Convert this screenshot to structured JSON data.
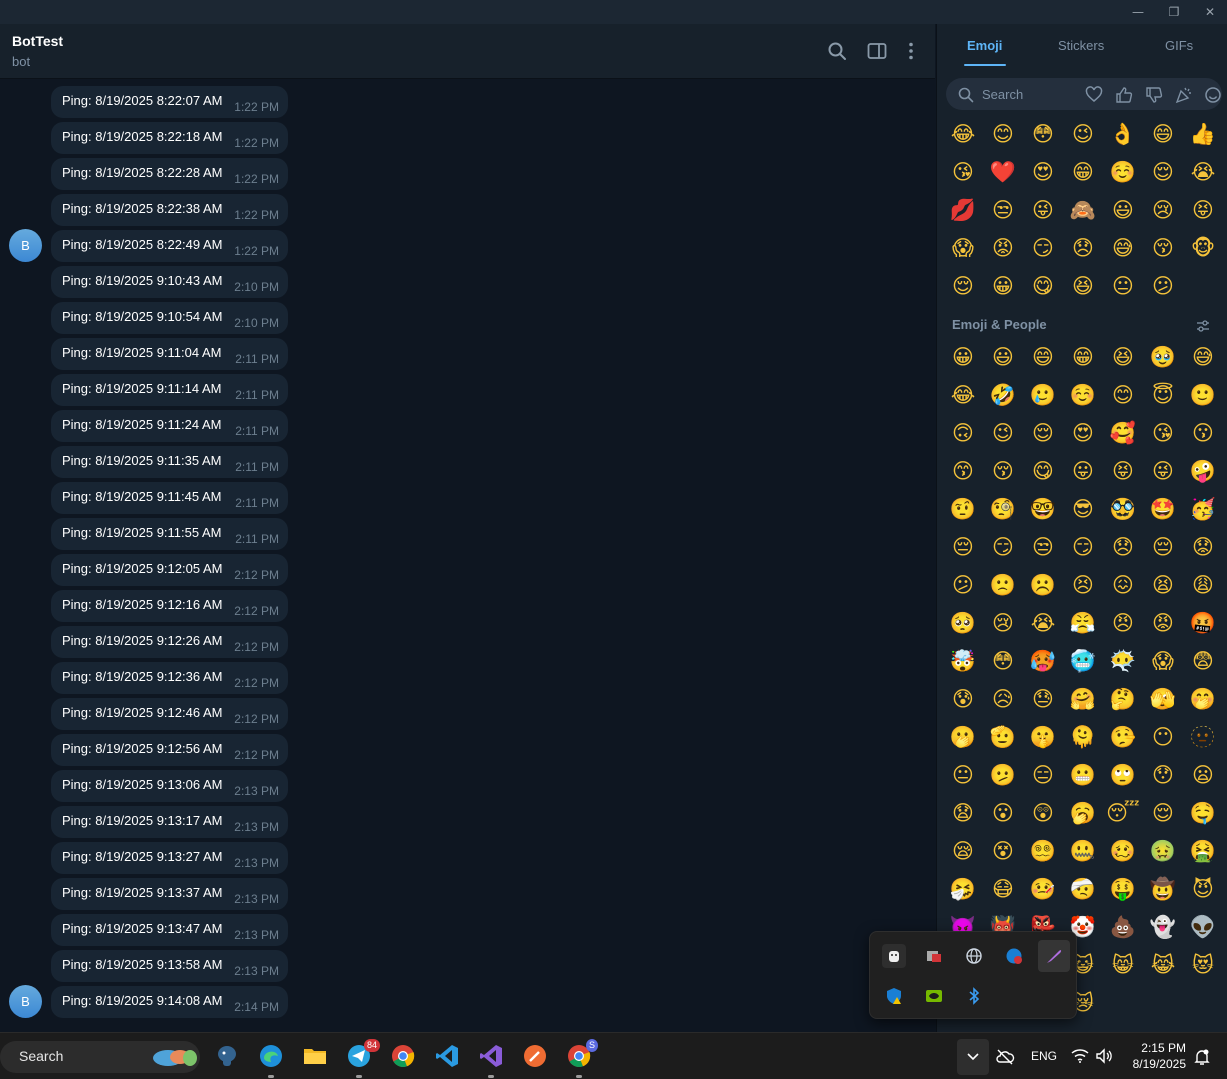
{
  "window": {
    "minimize_glyph": "—",
    "restore_glyph": "❐",
    "close_glyph": "✕"
  },
  "chat": {
    "title": "BotTest",
    "subtitle": "bot"
  },
  "messages": [
    {
      "text": "Ping: 8/19/2025 8:22:07 AM",
      "time": "1:22 PM",
      "avatar": ""
    },
    {
      "text": "Ping: 8/19/2025 8:22:18 AM",
      "time": "1:22 PM",
      "avatar": ""
    },
    {
      "text": "Ping: 8/19/2025 8:22:28 AM",
      "time": "1:22 PM",
      "avatar": ""
    },
    {
      "text": "Ping: 8/19/2025 8:22:38 AM",
      "time": "1:22 PM",
      "avatar": ""
    },
    {
      "text": "Ping: 8/19/2025 8:22:49 AM",
      "time": "1:22 PM",
      "avatar": "B"
    },
    {
      "text": "Ping: 8/19/2025 9:10:43 AM",
      "time": "2:10 PM",
      "avatar": ""
    },
    {
      "text": "Ping: 8/19/2025 9:10:54 AM",
      "time": "2:10 PM",
      "avatar": ""
    },
    {
      "text": "Ping: 8/19/2025 9:11:04 AM",
      "time": "2:11 PM",
      "avatar": ""
    },
    {
      "text": "Ping: 8/19/2025 9:11:14 AM",
      "time": "2:11 PM",
      "avatar": ""
    },
    {
      "text": "Ping: 8/19/2025 9:11:24 AM",
      "time": "2:11 PM",
      "avatar": ""
    },
    {
      "text": "Ping: 8/19/2025 9:11:35 AM",
      "time": "2:11 PM",
      "avatar": ""
    },
    {
      "text": "Ping: 8/19/2025 9:11:45 AM",
      "time": "2:11 PM",
      "avatar": ""
    },
    {
      "text": "Ping: 8/19/2025 9:11:55 AM",
      "time": "2:11 PM",
      "avatar": ""
    },
    {
      "text": "Ping: 8/19/2025 9:12:05 AM",
      "time": "2:12 PM",
      "avatar": ""
    },
    {
      "text": "Ping: 8/19/2025 9:12:16 AM",
      "time": "2:12 PM",
      "avatar": ""
    },
    {
      "text": "Ping: 8/19/2025 9:12:26 AM",
      "time": "2:12 PM",
      "avatar": ""
    },
    {
      "text": "Ping: 8/19/2025 9:12:36 AM",
      "time": "2:12 PM",
      "avatar": ""
    },
    {
      "text": "Ping: 8/19/2025 9:12:46 AM",
      "time": "2:12 PM",
      "avatar": ""
    },
    {
      "text": "Ping: 8/19/2025 9:12:56 AM",
      "time": "2:12 PM",
      "avatar": ""
    },
    {
      "text": "Ping: 8/19/2025 9:13:06 AM",
      "time": "2:13 PM",
      "avatar": ""
    },
    {
      "text": "Ping: 8/19/2025 9:13:17 AM",
      "time": "2:13 PM",
      "avatar": ""
    },
    {
      "text": "Ping: 8/19/2025 9:13:27 AM",
      "time": "2:13 PM",
      "avatar": ""
    },
    {
      "text": "Ping: 8/19/2025 9:13:37 AM",
      "time": "2:13 PM",
      "avatar": ""
    },
    {
      "text": "Ping: 8/19/2025 9:13:47 AM",
      "time": "2:13 PM",
      "avatar": ""
    },
    {
      "text": "Ping: 8/19/2025 9:13:58 AM",
      "time": "2:13 PM",
      "avatar": ""
    },
    {
      "text": "Ping: 8/19/2025 9:14:08 AM",
      "time": "2:14 PM",
      "avatar": "B"
    }
  ],
  "emoji_panel": {
    "tabs": [
      "Emoji",
      "Stickers",
      "GIFs"
    ],
    "active_tab": "Emoji",
    "search_placeholder": "Search",
    "search_category_icons": [
      "heart-icon",
      "thumbs-up-icon",
      "thumbs-down-icon",
      "party-icon",
      "smile-icon"
    ],
    "recent": [
      "😂",
      "😊",
      "😳",
      "😉",
      "👌",
      "😄",
      "👍",
      "😘",
      "❤️",
      "😍",
      "😁",
      "☺️",
      "😌",
      "😭",
      "💋",
      "😒",
      "😜",
      "🙈",
      "😃",
      "😢",
      "😝",
      "😱",
      "😡",
      "😏",
      "😞",
      "😅",
      "😚",
      "🐵",
      "😌",
      "😀",
      "😋",
      "😆",
      "😐",
      "😕"
    ],
    "section_title": "Emoji & People",
    "people": [
      "😀",
      "😃",
      "😄",
      "😁",
      "😆",
      "🥹",
      "😅",
      "😂",
      "🤣",
      "🥲",
      "☺️",
      "😊",
      "😇",
      "🙂",
      "🙃",
      "😉",
      "😌",
      "😍",
      "🥰",
      "😘",
      "😗",
      "😙",
      "😚",
      "😋",
      "😛",
      "😝",
      "😜",
      "🤪",
      "🤨",
      "🧐",
      "🤓",
      "😎",
      "🥸",
      "🤩",
      "🥳",
      "😔",
      "😏",
      "😒",
      "😏",
      "😞",
      "😔",
      "😟",
      "😕",
      "🙁",
      "☹️",
      "😣",
      "😖",
      "😫",
      "😩",
      "🥺",
      "😢",
      "😭",
      "😤",
      "😠",
      "😡",
      "🤬",
      "🤯",
      "😳",
      "🥵",
      "🥶",
      "😶‍🌫️",
      "😱",
      "😨",
      "😰",
      "😥",
      "😓",
      "🤗",
      "🤔",
      "🫣",
      "🤭",
      "🫢",
      "🫡",
      "🤫",
      "🫠",
      "🤥",
      "😶",
      "🫥",
      "😐",
      "🫤",
      "😑",
      "😬",
      "🙄",
      "😯",
      "😦",
      "😧",
      "😮",
      "😲",
      "🥱",
      "😴",
      "😌",
      "🤤",
      "😪",
      "😵",
      "😵‍💫",
      "🤐",
      "🥴",
      "🤢",
      "🤮",
      "🤧",
      "😷",
      "🤒",
      "🤕",
      "🤑",
      "🤠",
      "😈",
      "👿",
      "👹",
      "👺",
      "🤡",
      "💩",
      "👻",
      "👽",
      "👾",
      "🤖",
      "🎃",
      "😺",
      "😸",
      "😹",
      "😻",
      "😼",
      "😽",
      "🙀",
      "😿"
    ]
  },
  "tray_popup": {
    "icons": [
      "ghost-app-icon",
      "card-app-icon",
      "network-globe-icon",
      "edge-badge-icon",
      "feather-icon",
      "defender-warning-icon",
      "nvidia-icon",
      "bluetooth-icon"
    ]
  },
  "taskbar": {
    "search_label": "Search",
    "telegram_badge": "84",
    "chrome_badge": "S",
    "language": "ENG",
    "time": "2:15 PM",
    "date": "8/19/2025"
  },
  "colors": {
    "accent": "#5eb5f7",
    "bubble": "#182533",
    "background": "#0e1621",
    "panel": "#17212b"
  }
}
